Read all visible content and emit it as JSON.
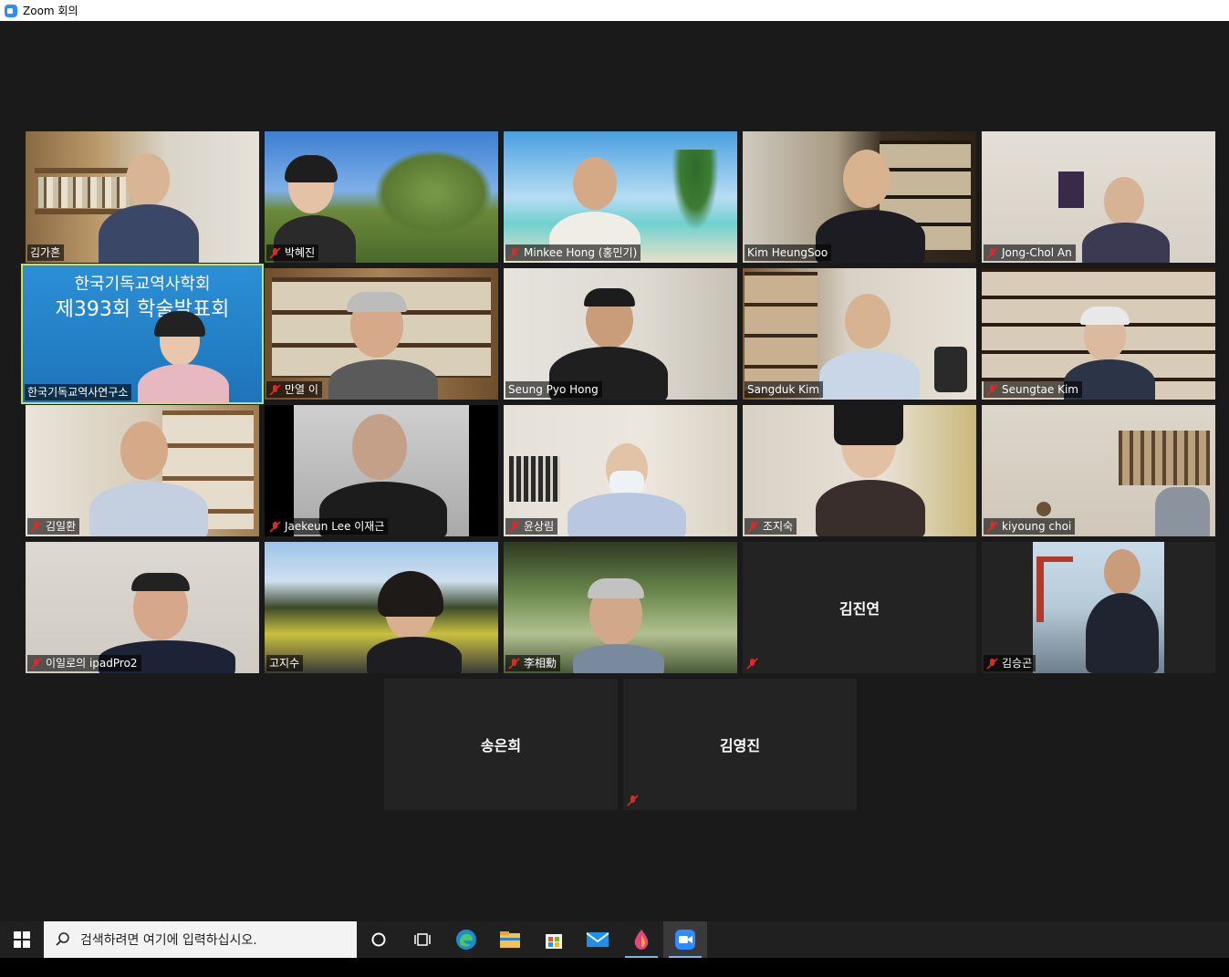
{
  "window": {
    "title": "Zoom 회의"
  },
  "tiles": [
    {
      "name": "김가흔",
      "muted": false
    },
    {
      "name": "박혜진",
      "muted": true
    },
    {
      "name": "Minkee Hong (홍민기)",
      "muted": true
    },
    {
      "name": "Kim HeungSoo",
      "muted": false
    },
    {
      "name": "Jong-Chol An",
      "muted": true
    },
    {
      "name": "한국기독교역사연구소",
      "muted": false,
      "banner_line1": "한국기독교역사학회",
      "banner_line2": "제393회 학술발표회"
    },
    {
      "name": "만열 이",
      "muted": true
    },
    {
      "name": "Seung Pyo Hong",
      "muted": false
    },
    {
      "name": "Sangduk Kim",
      "muted": false
    },
    {
      "name": "Seungtae Kim",
      "muted": true
    },
    {
      "name": "김일환",
      "muted": true
    },
    {
      "name": "Jaekeun Lee 이재근",
      "muted": true
    },
    {
      "name": "윤상림",
      "muted": true
    },
    {
      "name": "조지숙",
      "muted": true
    },
    {
      "name": "kiyoung choi",
      "muted": true
    },
    {
      "name": "이일로의 ipadPro2",
      "muted": true
    },
    {
      "name": "고지수",
      "muted": false
    },
    {
      "name": "李相勳",
      "muted": true
    },
    {
      "name": "김진연",
      "muted": true,
      "no_video": true
    },
    {
      "name": "김승곤",
      "muted": true
    },
    {
      "name": "송은희",
      "muted": false,
      "no_video": true
    },
    {
      "name": "김영진",
      "muted": true,
      "no_video": true
    }
  ],
  "taskbar": {
    "search_placeholder": "검색하려면 여기에 입력하십시오.",
    "icons": [
      "windows-start-icon",
      "search-icon",
      "cortana-icon",
      "task-view-icon",
      "edge-icon",
      "file-explorer-icon",
      "store-icon",
      "mail-icon",
      "paint-icon",
      "zoom-icon"
    ]
  },
  "colors": {
    "active_speaker_border": "#c3e35a",
    "background": "#1a1a1a",
    "mute_red": "#e02828",
    "zoom_blue": "#2d8cff"
  }
}
